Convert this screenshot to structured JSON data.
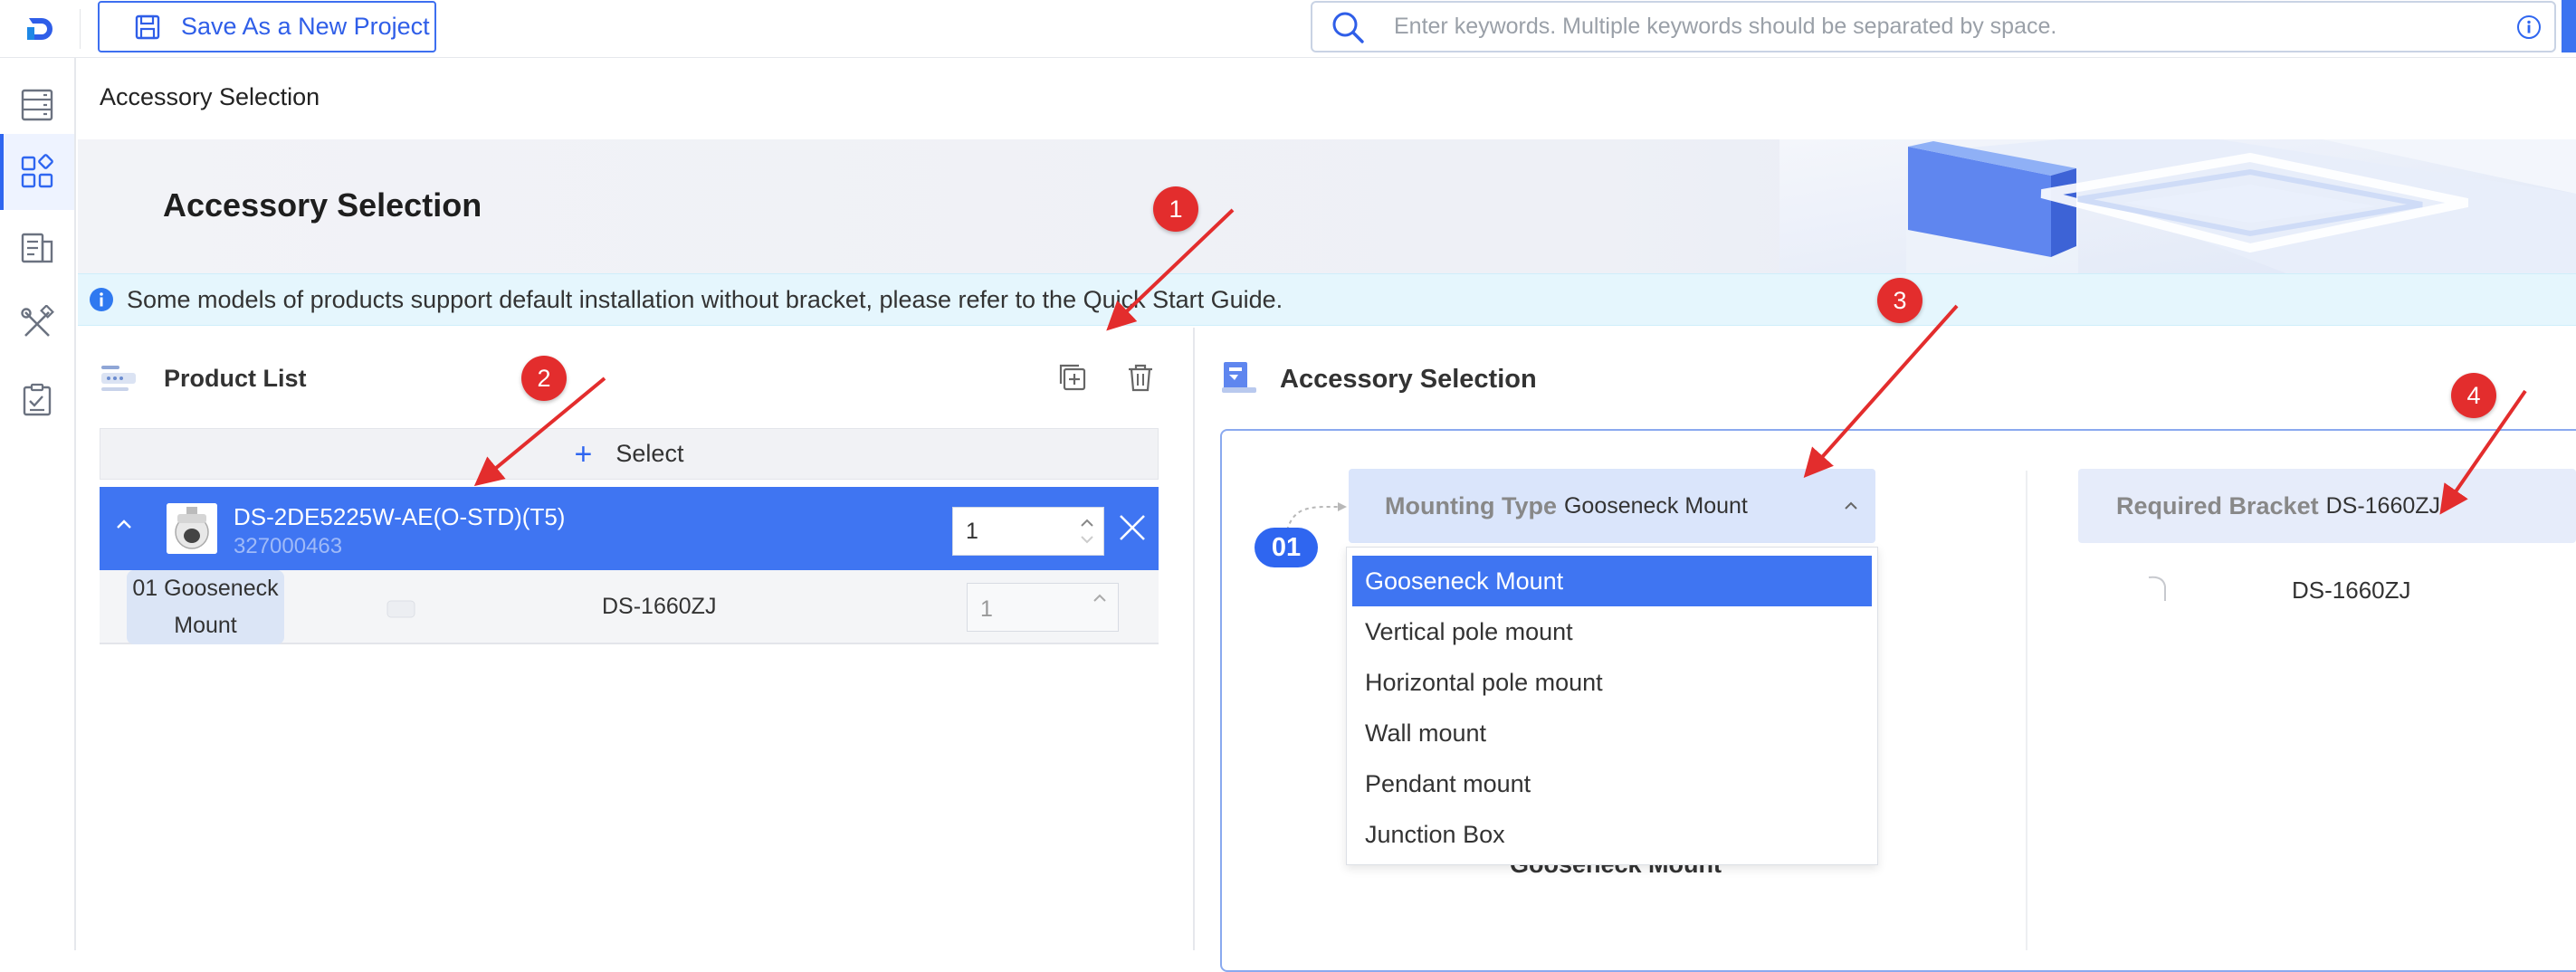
{
  "toolbar": {
    "save_label": "Save As a New Project"
  },
  "search": {
    "placeholder": "Enter keywords. Multiple keywords should be separated by space."
  },
  "sidebar": {
    "items": [
      {
        "icon": "list-icon"
      },
      {
        "icon": "grid-icon",
        "active": true
      },
      {
        "icon": "document-icon"
      },
      {
        "icon": "tools-icon"
      },
      {
        "icon": "clipboard-icon"
      }
    ]
  },
  "page": {
    "breadcrumb": "Accessory Selection",
    "banner_title": "Accessory Selection",
    "notice": "Some models of products support default installation without bracket, please refer to the Quick Start Guide."
  },
  "product_list": {
    "title": "Product List",
    "select_label": "Select",
    "product": {
      "model": "DS-2DE5225W-AE(O-STD)(T5)",
      "code": "327000463",
      "quantity": "1"
    },
    "accessory": {
      "tag": "01 Gooseneck Mount",
      "model": "DS-1660ZJ",
      "quantity": "1"
    }
  },
  "accessory_selection": {
    "title": "Accessory Selection",
    "step": "01",
    "mounting_type": {
      "label": "Mounting Type",
      "value": "Gooseneck Mount",
      "options": [
        "Gooseneck Mount",
        "Vertical pole mount",
        "Horizontal pole mount",
        "Wall mount",
        "Pendant mount",
        "Junction Box"
      ],
      "selected_index": 0
    },
    "under_text": "Gooseneck Mount",
    "required_bracket": {
      "label": "Required Bracket",
      "value": "DS-1660ZJ",
      "item_model": "DS-1660ZJ"
    }
  },
  "annotations": {
    "markers": [
      "1",
      "2",
      "3",
      "4"
    ],
    "color": "#e32d2d"
  },
  "colors": {
    "accent": "#3f75f2",
    "notice_bg": "#e5f6fd"
  }
}
